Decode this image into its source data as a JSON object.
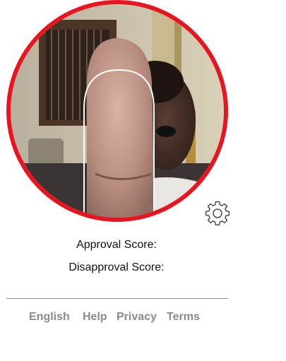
{
  "camera": {
    "ring_color": "#e8141f",
    "guide_outline_color": "#ffffff"
  },
  "settings": {
    "icon": "gear-icon"
  },
  "scores": {
    "approval_label": "Approval Score:",
    "disapproval_label": "Disapproval Score:"
  },
  "footer": {
    "links": [
      {
        "label": "English"
      },
      {
        "label": "Help"
      },
      {
        "label": "Privacy"
      },
      {
        "label": "Terms"
      }
    ],
    "link_color": "#8a8a8a"
  }
}
